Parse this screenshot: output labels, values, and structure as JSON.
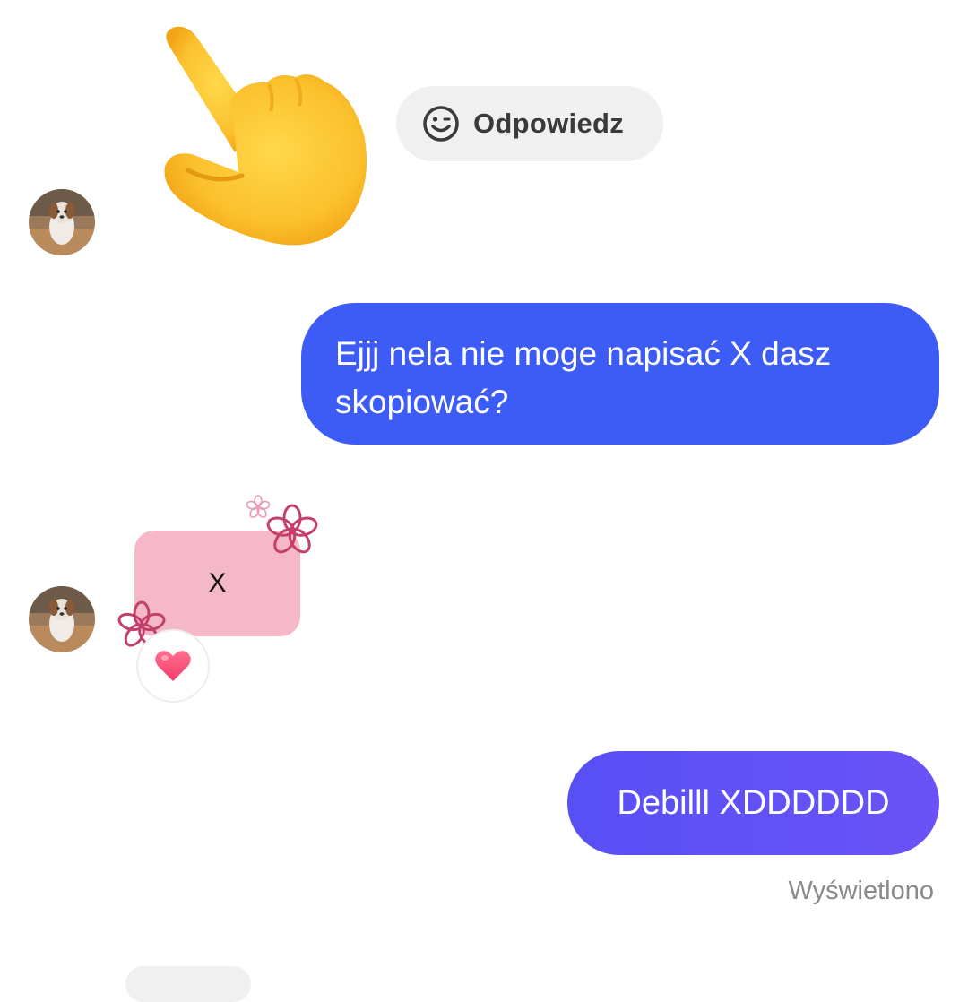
{
  "reply_chip": {
    "label": "Odpowiedz",
    "icon": "smile-icon"
  },
  "reaction_emoji": "pointing-hand",
  "messages": [
    {
      "direction": "outgoing",
      "text": "Ejjj nela nie moge napisać X dasz skopiować?"
    },
    {
      "direction": "incoming",
      "sticker_text": "X",
      "reaction": "heart"
    },
    {
      "direction": "outgoing",
      "text": "Debilll XDDDDDD"
    }
  ],
  "status": "Wyświetlono",
  "colors": {
    "outgoing_bubble": "#3d5cf5",
    "outgoing_bubble_2": "#5d51f5",
    "sticker_bg": "#f4b8c8",
    "flower": "#c2406a",
    "reply_chip_bg": "#f0f0f0"
  }
}
